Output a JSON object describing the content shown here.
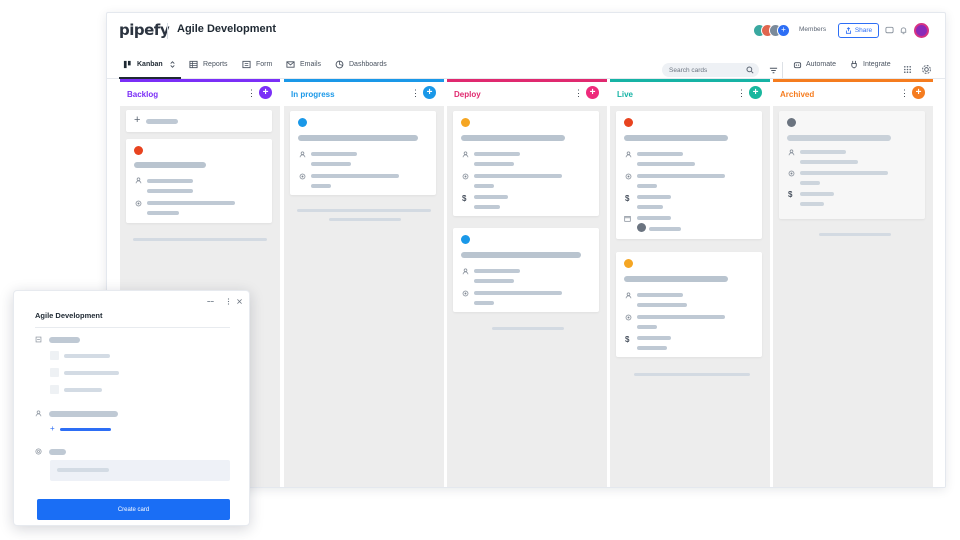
{
  "app": {
    "logo": "pipefy",
    "pipe_title": "Agile Development"
  },
  "header": {
    "members_label": "Members",
    "share_label": "Share",
    "avatars": [
      {
        "color": "#3aa8a0"
      },
      {
        "color": "#e0664f"
      },
      {
        "color": "#7b8a9a"
      },
      {
        "color": "#2d6ef5"
      }
    ]
  },
  "nav": {
    "tabs": [
      {
        "label": "Kanban",
        "icon": "kanban-icon",
        "active": true
      },
      {
        "label": "Reports",
        "icon": "table-icon"
      },
      {
        "label": "Form",
        "icon": "form-icon"
      },
      {
        "label": "Emails",
        "icon": "mail-icon"
      },
      {
        "label": "Dashboards",
        "icon": "chart-icon"
      }
    ],
    "search_placeholder": "Search cards",
    "automate_label": "Automate",
    "integrate_label": "Integrate"
  },
  "phases": [
    {
      "name": "Backlog",
      "color": "#7b2ff7",
      "add_color": "#7b2ff7"
    },
    {
      "name": "In progress",
      "color": "#1a98e8",
      "add_color": "#1a98e8"
    },
    {
      "name": "Deploy",
      "color": "#e0296f",
      "add_color": "#ee2a7b"
    },
    {
      "name": "Live",
      "color": "#16b3a5",
      "add_color": "#19b79e"
    },
    {
      "name": "Archived",
      "color": "#f57c1f",
      "add_color": "#f57c1f"
    }
  ],
  "card_dot_colors": {
    "red": "#e8431f",
    "blue": "#1a98e8",
    "yellow": "#f5a623",
    "gray": "#6b7480"
  },
  "modal": {
    "title": "Agile Development",
    "create_label": "Create card"
  }
}
